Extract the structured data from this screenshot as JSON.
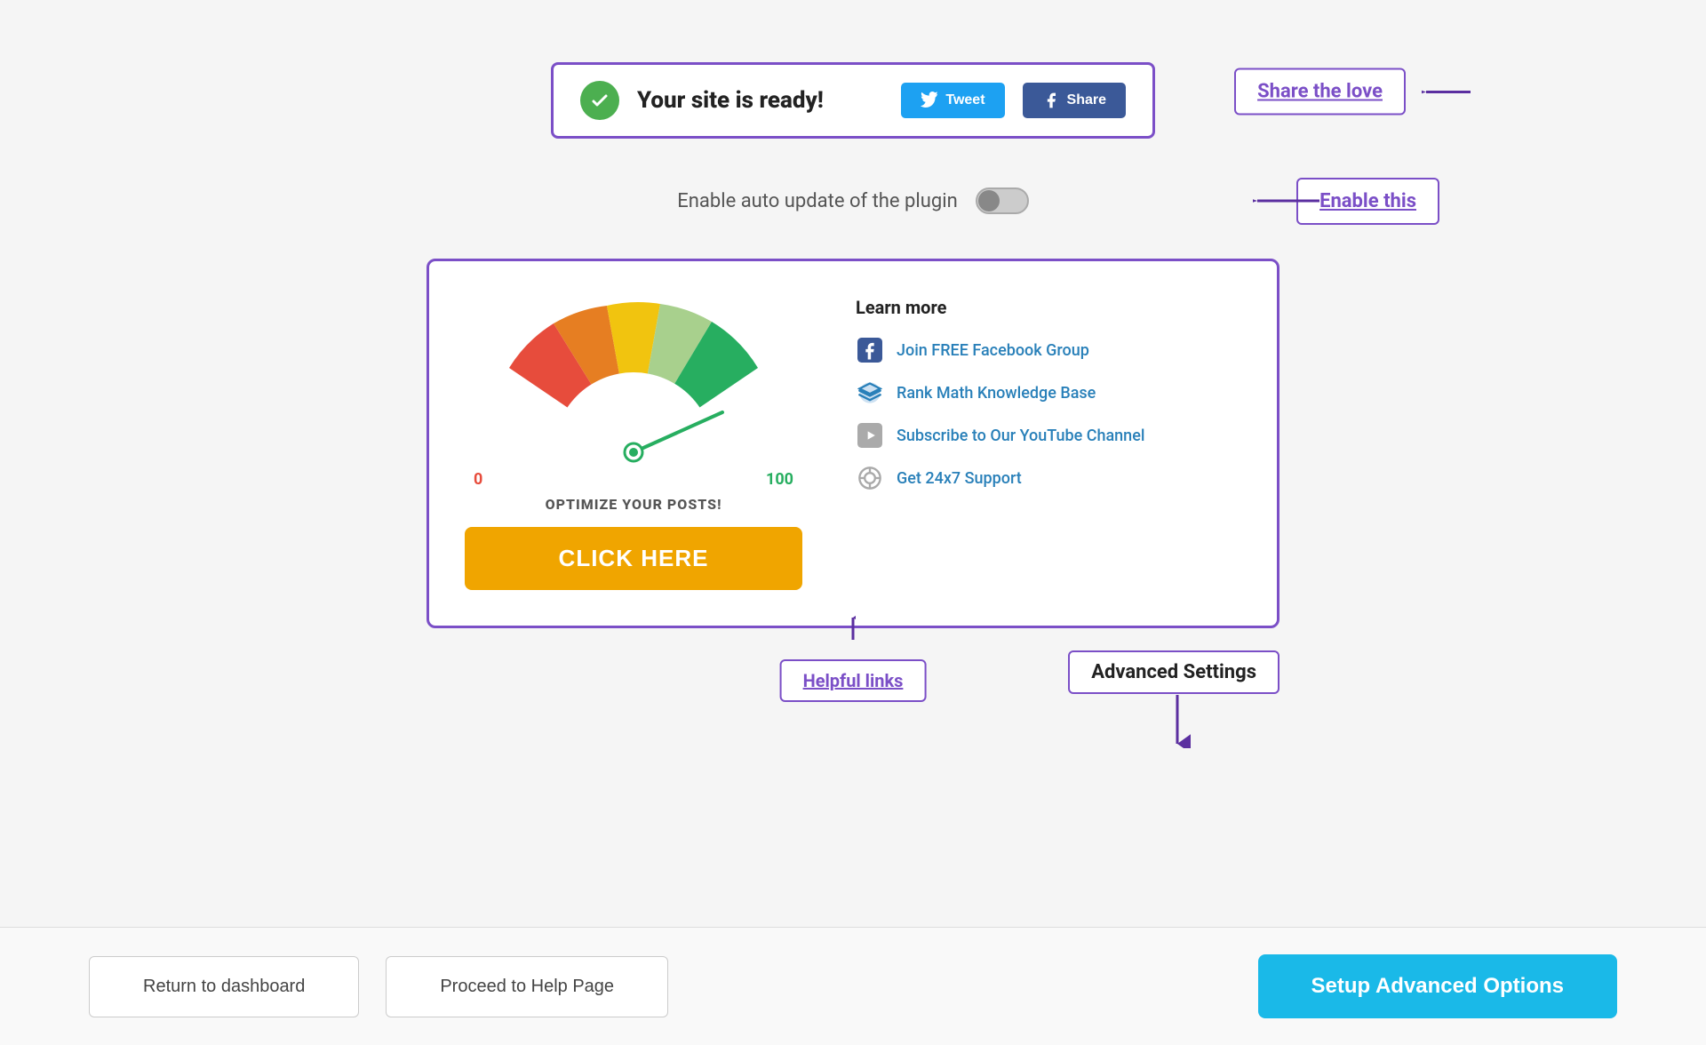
{
  "top_banner": {
    "site_ready_text": "Your site is ready!",
    "tweet_btn": "Tweet",
    "fb_share_btn": "Share",
    "border_color": "#7b4fc7"
  },
  "share_love": {
    "label": "Share the love"
  },
  "enable_section": {
    "label": "Enable auto update of the plugin",
    "annotation": "Enable this"
  },
  "gauge": {
    "label_0": "0",
    "label_100": "100",
    "optimize_text": "OPTIMIZE YOUR POSTS!",
    "click_here": "CLICK HERE"
  },
  "learn_more": {
    "title": "Learn more",
    "links": [
      {
        "icon": "facebook",
        "text": "Join FREE Facebook Group"
      },
      {
        "icon": "graduation",
        "text": "Rank Math Knowledge Base"
      },
      {
        "icon": "youtube",
        "text": "Subscribe to Our YouTube Channel"
      },
      {
        "icon": "support",
        "text": "Get 24x7 Support"
      }
    ]
  },
  "annotations": {
    "helpful_links": "Helpful links",
    "advanced_settings": "Advanced Settings"
  },
  "bottom_nav": {
    "return_dashboard": "Return to dashboard",
    "proceed_help": "Proceed to Help Page",
    "setup_advanced": "Setup Advanced Options"
  }
}
